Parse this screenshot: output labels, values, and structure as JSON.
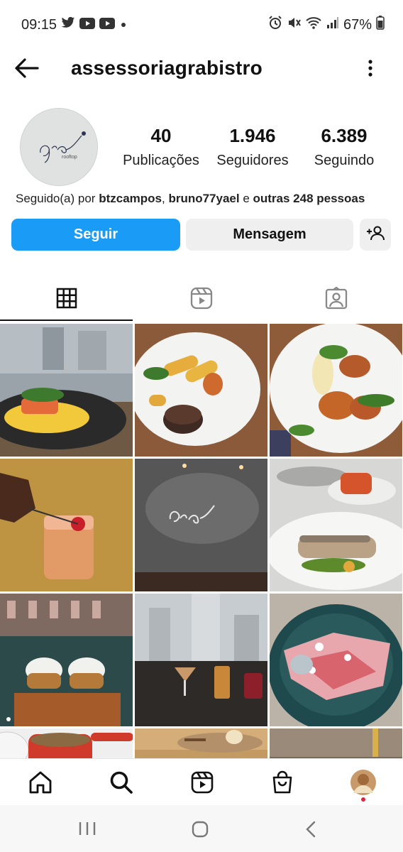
{
  "status_bar": {
    "time": "09:15",
    "left_icons": [
      "twitter-icon",
      "youtube-icon",
      "youtube-icon",
      "dot-icon"
    ],
    "right_icons": [
      "alarm-icon",
      "mute-icon",
      "wifi-icon",
      "signal-icon"
    ],
    "battery": "67%"
  },
  "header": {
    "username": "assessoriagrabistro"
  },
  "profile": {
    "logo_text": "grá",
    "logo_subtext": "rooftop",
    "stats": [
      {
        "value": "40",
        "label": "Publicações"
      },
      {
        "value": "1.946",
        "label": "Seguidores"
      },
      {
        "value": "6.389",
        "label": "Seguindo"
      }
    ],
    "followed_by": {
      "prefix": "Seguido(a) por ",
      "user1": "btzcampos",
      "sep": ", ",
      "user2": "bruno77yael",
      "and": " e ",
      "others": "outras 248 pessoas"
    }
  },
  "actions": {
    "follow_label": "Seguir",
    "message_label": "Mensagem"
  },
  "tabs": [
    "grid-icon",
    "reels-icon",
    "tagged-icon"
  ],
  "colors": {
    "accent": "#1a9bf5",
    "secondary_button": "#efefef"
  },
  "grid_posts": [
    "salmon-on-puree",
    "filet-mignon-potatoes",
    "glazed-chicken-salad",
    "cocktail-cherry",
    "gra-logo-wall",
    "grilled-fish-plate",
    "fried-chicken-sandwiches",
    "city-view-drinks",
    "dessert-bowl"
  ],
  "bottom_nav": [
    "home-icon",
    "search-icon",
    "reels-icon",
    "shop-icon",
    "profile-avatar"
  ]
}
